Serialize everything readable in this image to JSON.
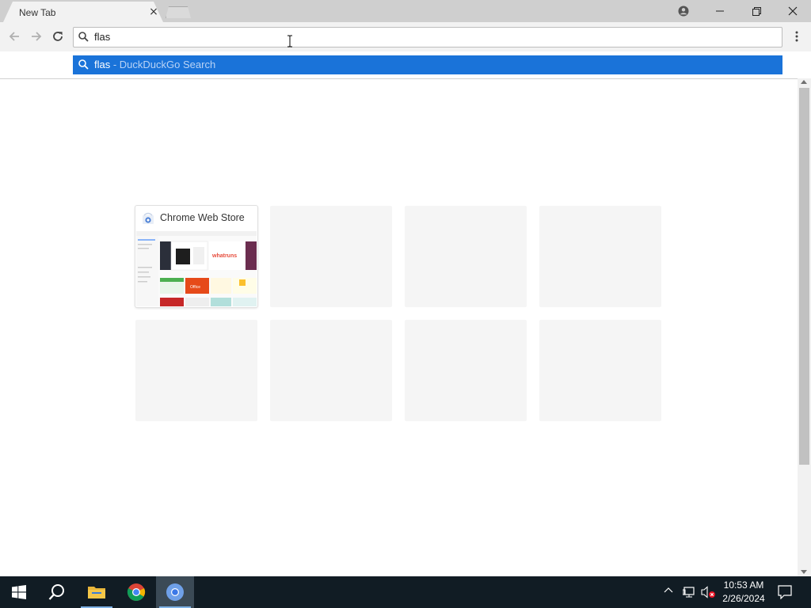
{
  "browser": {
    "tab_title": "New Tab",
    "tab_close": "×",
    "omnibox_value": "flas",
    "icons": [
      "profile-icon",
      "minimize-icon",
      "maximize-icon",
      "close-icon",
      "back-icon",
      "forward-icon",
      "reload-icon",
      "search-icon",
      "menu-icon"
    ]
  },
  "suggestion": {
    "query": "flas",
    "separator": " - ",
    "engine": "DuckDuckGo Search"
  },
  "tiles": [
    {
      "title": "Chrome Web Store",
      "filled": true
    },
    {
      "title": "",
      "filled": false
    },
    {
      "title": "",
      "filled": false
    },
    {
      "title": "",
      "filled": false
    },
    {
      "title": "",
      "filled": false
    },
    {
      "title": "",
      "filled": false
    },
    {
      "title": "",
      "filled": false
    },
    {
      "title": "",
      "filled": false
    }
  ],
  "thumbnail_texts": {
    "whatruns": "whatruns",
    "office": "Office"
  },
  "taskbar": {
    "time": "10:53 AM",
    "date": "2/26/2024",
    "accent": "#1a73d9"
  }
}
